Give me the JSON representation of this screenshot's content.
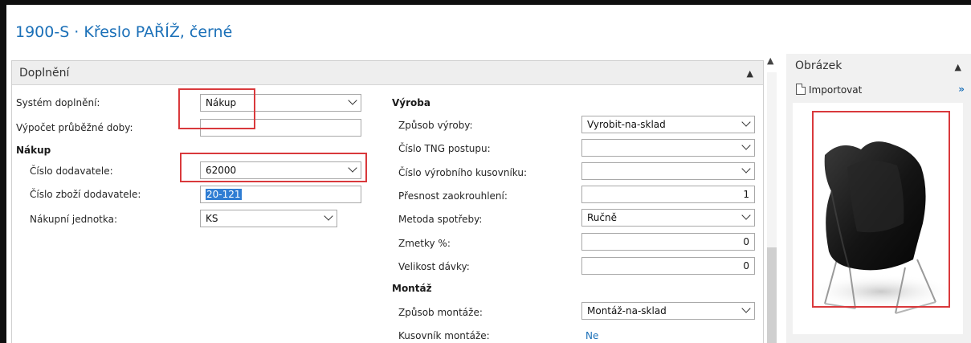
{
  "page": {
    "title": "1900-S · Křeslo PAŘÍŽ, černé"
  },
  "replenishment": {
    "header": "Doplnění",
    "left": {
      "system_label": "Systém doplnění:",
      "system_value": "Nákup",
      "lead_time_label": "Výpočet průběžné doby:",
      "lead_time_value": "",
      "purchase_group": "Nákup",
      "vendor_no_label": "Číslo dodavatele:",
      "vendor_no_value": "62000",
      "vendor_item_label": "Číslo zboží dodavatele:",
      "vendor_item_value": "20-121",
      "purch_uom_label": "Nákupní jednotka:",
      "purch_uom_value": "KS"
    },
    "right": {
      "production_group": "Výroba",
      "manuf_policy_label": "Způsob výroby:",
      "manuf_policy_value": "Vyrobit-na-sklad",
      "routing_no_label": "Číslo TNG postupu:",
      "routing_no_value": "",
      "bom_no_label": "Číslo výrobního kusovníku:",
      "bom_no_value": "",
      "rounding_label": "Přesnost zaokrouhlení:",
      "rounding_value": "1",
      "flushing_label": "Metoda spotřeby:",
      "flushing_value": "Ručně",
      "scrap_label": "Zmetky %:",
      "scrap_value": "0",
      "lot_size_label": "Velikost dávky:",
      "lot_size_value": "0",
      "assembly_group": "Montáž",
      "assembly_policy_label": "Způsob montáže:",
      "assembly_policy_value": "Montáž-na-sklad",
      "assembly_bom_label": "Kusovník montáže:",
      "assembly_bom_value": "Ne"
    }
  },
  "picture": {
    "title": "Obrázek",
    "import_label": "Importovat",
    "more_label": "»"
  },
  "icons": {
    "collapse": "chevron-up-icon",
    "dropdown": "chevron-down-icon",
    "import": "document-import-icon",
    "chair": "chair-image"
  },
  "colors": {
    "title_blue": "#1b70b8",
    "annotation_red": "#d9393c",
    "selection_blue": "#2f7dd3"
  }
}
